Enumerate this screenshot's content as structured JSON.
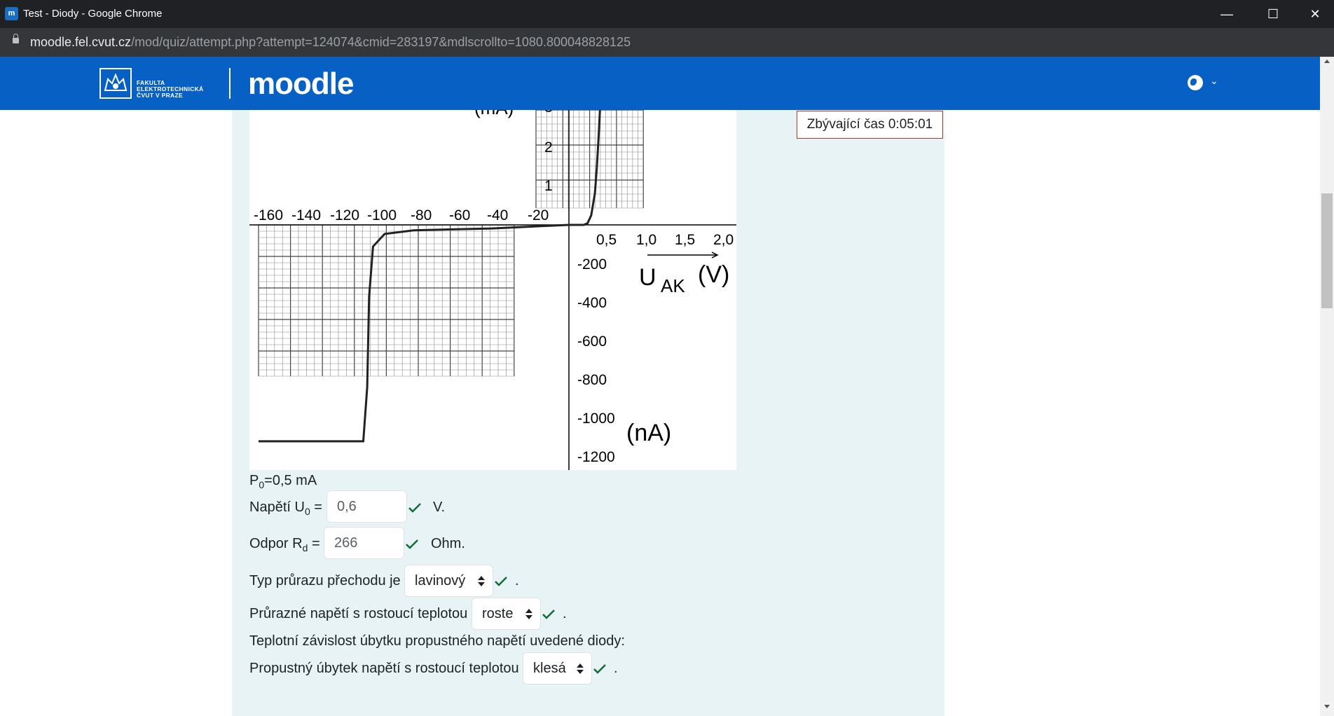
{
  "window": {
    "title": "Test - Diody - Google Chrome",
    "favicon_text": "m",
    "minimize": "—",
    "maximize": "☐",
    "close": "✕"
  },
  "address": {
    "host": "moodle.fel.cvut.cz",
    "path": "/mod/quiz/attempt.php?attempt=124074&cmid=283197&mdlscrollto=1080.800048828125"
  },
  "navbar": {
    "fel_lines": [
      "FAKULTA",
      "ELEKTROTECHNICKÁ",
      "ČVUT V PRAZE"
    ],
    "moodle_logo": "moodle",
    "language_icon": "globe-icon",
    "caret_icon": "chevron-down-icon"
  },
  "timer": {
    "label": "Zbývající čas 0:05:01"
  },
  "graph": {
    "x_neg_ticks": [
      "-160",
      "-140",
      "-120",
      "-100",
      "-80",
      "-60",
      "-40",
      "-20"
    ],
    "x_pos_ticks": [
      "0,5",
      "1,0",
      "1,5",
      "2,0"
    ],
    "y_pos_ticks": [
      "2",
      "1"
    ],
    "y_pos_partial": "3",
    "y_neg_ticks": [
      "-200",
      "-400",
      "-600",
      "-800",
      "-1000",
      "-1200"
    ],
    "x_axis_label_main": "U",
    "x_axis_label_sub": "AK",
    "x_axis_unit": "(V)",
    "y_neg_unit": "(nA)",
    "y_pos_unit_partial": "(mA)"
  },
  "chart_data": {
    "type": "line",
    "xlabel": "U AK (V)",
    "x_ticks_reverse": [
      "-160",
      "-140",
      "-120",
      "-100",
      "-80",
      "-60",
      "-40",
      "-20"
    ],
    "x_ticks_forward": [
      "0,5",
      "1,0",
      "1,5",
      "2,0"
    ],
    "y_ticks_forward": [
      "1",
      "2",
      "3"
    ],
    "y_ticks_reverse": [
      "-200",
      "-400",
      "-600",
      "-800",
      "-1000",
      "-1200"
    ],
    "y_units": [
      "(mA)",
      "(nA)"
    ],
    "series": [
      {
        "x": [
          -160,
          -106,
          -104,
          -103,
          -101,
          -95,
          -80,
          -40,
          0,
          0.4,
          0.5,
          0.6,
          0.7,
          0.75,
          0.8,
          0.85
        ],
        "y": [
          -1200,
          -1200,
          -900,
          -400,
          -120,
          -50,
          -30,
          -20,
          0,
          0,
          0.05,
          0.3,
          1,
          1.8,
          2.8,
          4
        ]
      }
    ]
  },
  "question": {
    "p0_main": "P",
    "p0_sub": "0",
    "p0_rest": "=0,5 mA",
    "u0_label_main": "Napětí U",
    "u0_label_sub": "0",
    "u0_label_eq": " =",
    "u0_value": "0,6",
    "u0_unit": "V.",
    "rd_label_main": "Odpor R",
    "rd_label_sub": "d",
    "rd_label_eq": " =",
    "rd_value": "266",
    "rd_unit": "Ohm.",
    "type_label": "Typ průrazu přechodu je",
    "type_value": "lavinový",
    "breakdown_label": "Průrazné napětí s rostoucí teplotou",
    "breakdown_value": "roste",
    "temp_dependency_text": "Teplotní závislost úbytku propustného napětí uvedené diody:",
    "forward_label": "Propustný úbytek napětí s rostoucí teplotou",
    "forward_value": "klesá",
    "period": ".",
    "correct_color": "#0f6c34"
  }
}
